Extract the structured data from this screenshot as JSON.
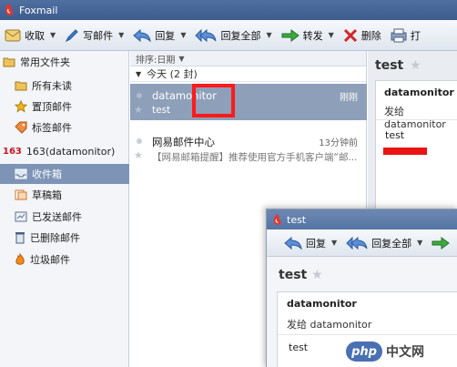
{
  "window": {
    "title": "Foxmail"
  },
  "toolbar": {
    "receive": "收取",
    "compose": "写邮件",
    "reply": "回复",
    "reply_all": "回复全部",
    "forward": "转发",
    "delete": "删除",
    "print": "打"
  },
  "sidebar": {
    "common_section": "常用文件夹",
    "all_unread": "所有未读",
    "starred": "置顶邮件",
    "tagged": "标签邮件",
    "account_badge": "163",
    "account": "163(datamonitor)",
    "inbox": "收件箱",
    "drafts": "草稿箱",
    "sent": "已发送邮件",
    "deleted": "已删除邮件",
    "junk": "垃圾邮件"
  },
  "list": {
    "sort_label": "排序:日期",
    "group_today": "今天 (2 封)",
    "mails": [
      {
        "sender": "datamonitor",
        "subject": "test",
        "time": "刚刚"
      },
      {
        "sender": "网易邮件中心",
        "subject": "【网易邮箱提醒】推荐使用官方手机客户端“邮...",
        "time": "13分钟前"
      }
    ]
  },
  "reading": {
    "subject": "test",
    "from": "datamonitor",
    "to": "发给 datamonitor",
    "body": "test"
  },
  "popup": {
    "title": "test",
    "reply": "回复",
    "reply_all": "回复全部",
    "subject": "test",
    "from": "datamonitor",
    "to": "发给 datamonitor",
    "body": "test"
  },
  "watermark": {
    "logo": "php",
    "text": "中文网"
  },
  "colors": {
    "accent": "#3d5c8e",
    "selected": "#7d94b6",
    "highlight": "#ff1a1a"
  }
}
